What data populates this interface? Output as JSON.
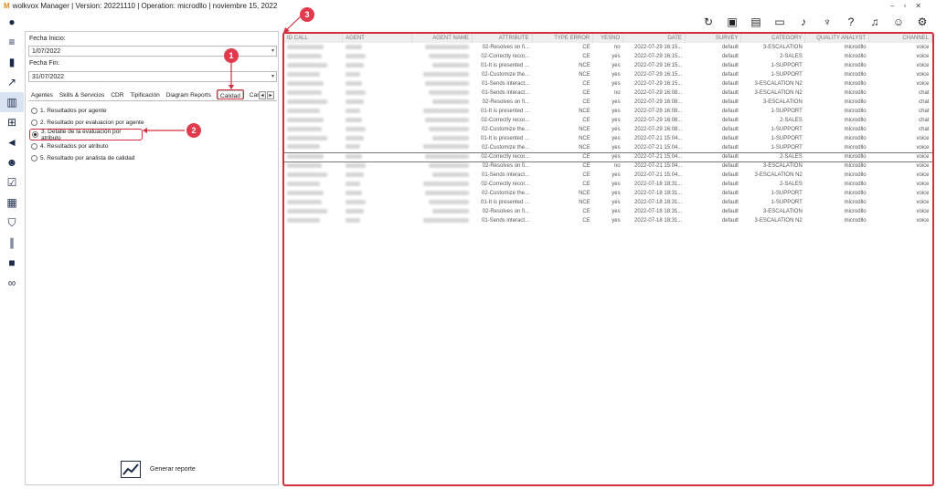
{
  "window": {
    "title": "wolkvox Manager  | Version: 20221110  |  Operation: microdllo | noviembre 15, 2022",
    "logo": "M"
  },
  "colors": {
    "accent": "#d32f3f",
    "sidebar_icon": "#1c2b4a"
  },
  "toolbar_icons": [
    "refresh-icon",
    "briefcase-icon",
    "book-icon",
    "contact-card-icon",
    "music-note-icon",
    "microphone-icon",
    "help-icon",
    "bell-icon",
    "user-icon",
    "gear-icon"
  ],
  "sidebar_icons": [
    "user-avatar-icon",
    "menu-icon",
    "bar-chart-icon",
    "trend-chart-icon",
    "report-icon",
    "org-chart-icon",
    "megaphone-icon",
    "team-icon",
    "checklist-icon",
    "calculator-icon",
    "shield-icon",
    "audio-wave-icon",
    "video-camera-icon",
    "voicemail-icon"
  ],
  "filters": {
    "start_label": "Fecha Inicio:",
    "start_value": "1/07/2022",
    "end_label": "Fecha Fin:",
    "end_value": "31/07/2022"
  },
  "tabs": [
    "Agentes",
    "Skills & Servicios",
    "CDR",
    "Tipificación",
    "Diagram Reports",
    "Calidad",
    "Cam"
  ],
  "radio_options": [
    {
      "label": "1. Resultados por agente",
      "checked": false
    },
    {
      "label": "2. Resultado por evaluacion por agente",
      "checked": false
    },
    {
      "label": "3. Detalle de la evaluación por atributo",
      "checked": true
    },
    {
      "label": "4. Resultados por atributo",
      "checked": false
    },
    {
      "label": "5. Resultado por analista de calidad",
      "checked": false
    }
  ],
  "callouts": [
    "1",
    "2",
    "3"
  ],
  "generate_label": "Generar reporte",
  "table": {
    "columns": [
      "ID CALL",
      "AGENT",
      "AGENT NAME",
      "ATTRIBUTE",
      "TYPE ERROR",
      "YESNO",
      "DATE",
      "SURVEY",
      "CATEGORY",
      "QUALITY ANALYST",
      "CHANNEL"
    ],
    "rows": [
      [
        "",
        "",
        "",
        "02-Resolves on fi...",
        "CE",
        "no",
        "2022-07-29 16:15...",
        "default",
        "3-ESCALATION",
        "microdllo",
        "voice"
      ],
      [
        "",
        "",
        "",
        "02-Correctly recor...",
        "CE",
        "yes",
        "2022-07-29 16:15...",
        "default",
        "2-SALES",
        "microdllo",
        "voice"
      ],
      [
        "",
        "",
        "",
        "01-It is presented ...",
        "NCE",
        "yes",
        "2022-07-29 16:15...",
        "default",
        "1-SUPPORT",
        "microdllo",
        "voice"
      ],
      [
        "",
        "",
        "",
        "02-Customize the...",
        "NCE",
        "yes",
        "2022-07-29 16:15...",
        "default",
        "1-SUPPORT",
        "microdllo",
        "voice"
      ],
      [
        "",
        "",
        "",
        "01-Sends interact...",
        "CE",
        "yes",
        "2022-07-29 16:15...",
        "default",
        "3-ESCALATION N2",
        "microdllo",
        "voice"
      ],
      [
        "",
        "",
        "",
        "01-Sends interact...",
        "CE",
        "no",
        "2022-07-29 16:08...",
        "default",
        "3-ESCALATION N2",
        "microdllo",
        "chat"
      ],
      [
        "",
        "",
        "",
        "02-Resolves on fi...",
        "CE",
        "yes",
        "2022-07-29 16:08...",
        "default",
        "3-ESCALATION",
        "microdllo",
        "chat"
      ],
      [
        "",
        "",
        "",
        "01-It is presented ...",
        "NCE",
        "yes",
        "2022-07-29 16:08...",
        "default",
        "1-SUPPORT",
        "microdllo",
        "chat"
      ],
      [
        "",
        "",
        "",
        "02-Correctly recor...",
        "CE",
        "yes",
        "2022-07-29 16:08...",
        "default",
        "2-SALES",
        "microdllo",
        "chat"
      ],
      [
        "",
        "",
        "",
        "02-Customize the...",
        "NCE",
        "yes",
        "2022-07-29 16:08...",
        "default",
        "1-SUPPORT",
        "microdllo",
        "chat"
      ],
      [
        "",
        "",
        "",
        "01-It is presented ...",
        "NCE",
        "yes",
        "2022-07-21 15:04...",
        "default",
        "1-SUPPORT",
        "microdllo",
        "voice"
      ],
      [
        "",
        "",
        "",
        "02-Customize the...",
        "NCE",
        "yes",
        "2022-07-21 15:04...",
        "default",
        "1-SUPPORT",
        "microdllo",
        "voice"
      ],
      [
        "",
        "",
        "",
        "02-Correctly recor...",
        "CE",
        "yes",
        "2022-07-21 15:04...",
        "default",
        "2-SALES",
        "microdllo",
        "voice"
      ],
      [
        "",
        "",
        "",
        "02-Resolves on fi...",
        "CE",
        "no",
        "2022-07-21 15:04...",
        "default",
        "3-ESCALATION",
        "microdllo",
        "voice"
      ],
      [
        "",
        "",
        "",
        "01-Sends interact...",
        "CE",
        "yes",
        "2022-07-21 15:04...",
        "default",
        "3-ESCALATION N2",
        "microdllo",
        "voice"
      ],
      [
        "",
        "",
        "",
        "02-Correctly recor...",
        "CE",
        "yes",
        "2022-07-18 18:31...",
        "default",
        "2-SALES",
        "microdllo",
        "voice"
      ],
      [
        "",
        "",
        "",
        "02-Customize the...",
        "NCE",
        "yes",
        "2022-07-18 18:31...",
        "default",
        "1-SUPPORT",
        "microdllo",
        "voice"
      ],
      [
        "",
        "",
        "",
        "01-It is presented ...",
        "NCE",
        "yes",
        "2022-07-18 18:31...",
        "default",
        "1-SUPPORT",
        "microdllo",
        "voice"
      ],
      [
        "",
        "",
        "",
        "02-Resolves on fi...",
        "CE",
        "yes",
        "2022-07-18 18:31...",
        "default",
        "3-ESCALATION",
        "microdllo",
        "voice"
      ],
      [
        "",
        "",
        "",
        "01-Sends interact...",
        "CE",
        "yes",
        "2022-07-18 18:31...",
        "default",
        "3-ESCALATION N2",
        "microdllo",
        "voice"
      ]
    ],
    "selected_row": 12
  }
}
